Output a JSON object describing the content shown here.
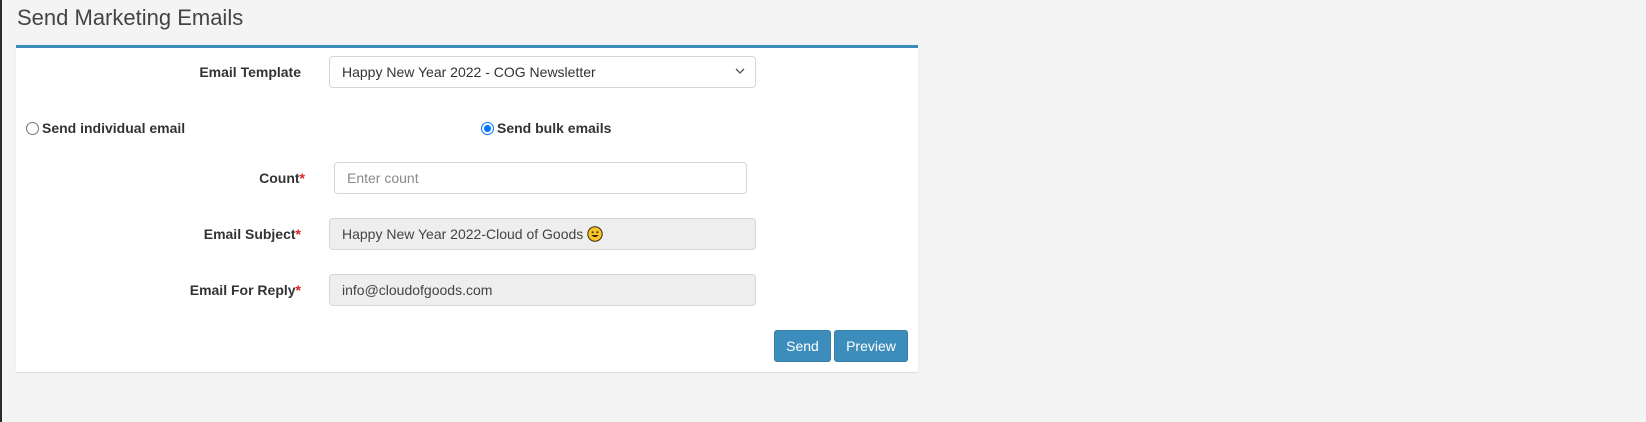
{
  "page": {
    "title": "Send Marketing Emails"
  },
  "form": {
    "template": {
      "label": "Email Template",
      "selected": "Happy New Year 2022 - COG Newsletter"
    },
    "radios": {
      "individual": {
        "label": "Send individual email",
        "checked": false
      },
      "bulk": {
        "label": "Send bulk emails",
        "checked": true
      }
    },
    "count": {
      "label": "Count",
      "required_mark": "*",
      "placeholder": "Enter count",
      "value": ""
    },
    "subject": {
      "label": "Email Subject",
      "required_mark": "*",
      "value": "Happy New Year 2022-Cloud of Goods",
      "emoji_icon": "smiley-face-icon"
    },
    "reply": {
      "label": "Email For Reply",
      "required_mark": "*",
      "value": "info@cloudofgoods.com"
    }
  },
  "buttons": {
    "send": "Send",
    "preview": "Preview"
  },
  "colors": {
    "accent": "#3c8dbc",
    "required": "#dd1f26",
    "radio_checked": "#0075ff",
    "disabled_bg": "#eeeeee"
  }
}
